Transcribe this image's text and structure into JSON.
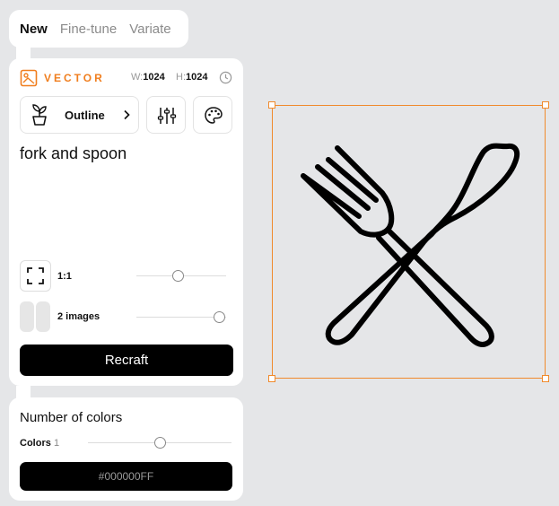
{
  "tabs": [
    {
      "label": "New",
      "active": true
    },
    {
      "label": "Fine-tune",
      "active": false
    },
    {
      "label": "Variate",
      "active": false
    }
  ],
  "header": {
    "model_label": "VECTOR",
    "width_label": "W:",
    "width_value": "1024",
    "height_label": "H:",
    "height_value": "1024",
    "history_icon": "clock-icon"
  },
  "style": {
    "label": "Outline",
    "icon": "plant-pot-icon"
  },
  "tools": {
    "settings_icon": "sliders-icon",
    "palette_icon": "palette-icon"
  },
  "prompt": {
    "value": "fork and spoon"
  },
  "aspect": {
    "label": "1:1",
    "slider_fraction": 0.5
  },
  "images": {
    "label": "2 images",
    "slider_fraction": 1.0
  },
  "generate_button": "Recraft",
  "colors_panel": {
    "title": "Number of colors",
    "colors_label": "Colors",
    "colors_value": "1",
    "slider_fraction": 0.5,
    "color_hex": "#000000FF"
  },
  "canvas": {
    "image_subject": "fork-and-spoon-outline",
    "selection_color": "#f08a2c"
  },
  "colors": {
    "accent": "#f07e1e",
    "background": "#e5e6e8",
    "button": "#000000"
  }
}
